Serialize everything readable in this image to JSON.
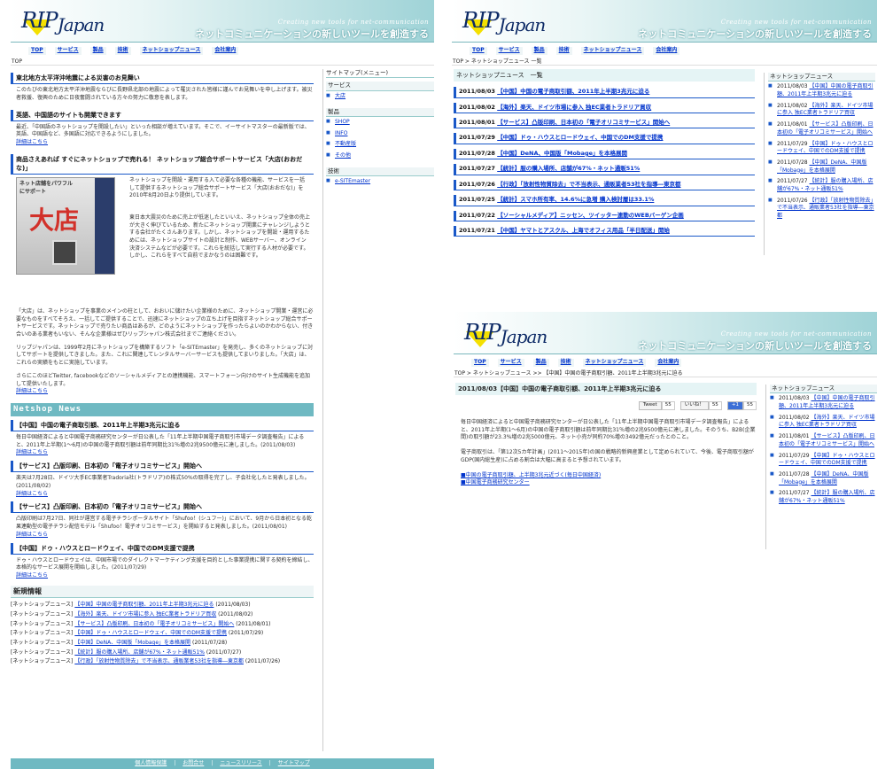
{
  "header": {
    "logo_rip": "RIP",
    "logo_japan": "Japan",
    "tagline_en": "Creating new tools for net-communication",
    "tagline_jp": "ネットコミュニケーションの新しいツールを創造する"
  },
  "nav": [
    "TOP",
    "サービス",
    "製品",
    "技術",
    "ネットショップニュース",
    "会社案内"
  ],
  "left": {
    "breadcrumb": "TOP",
    "sections": [
      {
        "title": "東北地方太平洋沖地震による災害のお見舞い",
        "body": "このたびの東北地方太平洋沖地震ならびに長野県北部の地震によって罹災された皆様に謹んでお見舞いを申し上げます。被災者救援、復興のために日夜奮闘されている方々の努力に敬意を表します。",
        "more": ""
      },
      {
        "title": "英語、中国語のサイトも開業できます",
        "body": "最近、「中国語のネットショップを開設したい」といった相談が増えています。そこで、イーサイトマスターの最新版では、英語、中国語など、多国語に対応できるようにしました。",
        "more": "詳細はこちら"
      },
      {
        "title": "商品さえあれば すぐにネットショップで売れる！ ネットショップ総合サポートサービス「大店(おおだな)」",
        "body": "ネットショップを開設・運用する入て必要な各種の機能、サービスを一括して提供するネットショップ総合サポートサービス「大店(おおだな)」を2010年8月20日より提供しています。",
        "more": ""
      }
    ],
    "odana_banner_title": "大店",
    "odana_banner_sub": "ネット店舗をパワフルにサポート",
    "odana_para2": "東日本大震災のために売上が低迷したといいえ、ネットショップ全体の売上が大きく伸びているため、新たにネットショップ開業にチャレンジしようとする会社がたくさんあります。しかし、ネットショップを開設・運用するためには、ネットショップサイトの設計と制作、WEBサーバー、オンライン決済システムなどが必要です。これらを統括して実行する人材が必要です。しかし、これらをすべて自前でまかなうのは困難です。",
    "odana_para3": "「大店」は、ネットショップを事業のメインの柱として、おおいに儲けたい企業様のために、ネットショップ開業・運営に必要なものをすべてそろえ、一括してご提供することで、迅速にネットショップの立ち上げを目指すネットショップ総合サポートサービスです。ネットショップで売りたい商品はあるが、どのようにネットショップを作ったらよいのかわからない、付き合いのある業者もいない、そんな企業様はぜひリップシャパン株式会社までご連絡ください。",
    "odana_para4": "リップジャパンは、1999年2月にネットショップを構築するソフト「e-SITEmaster」を発売し、多くのネットショップに対してサポートを提供してきました。また、これに関連してレンタルサーバーサービスも提供してまいりました。「大店」は、これらの実績をもとに実施しています。",
    "odana_para5": "さらにこのほどTwitter, facebookなどのソーシャルメディアとの連携機能、スマートフォーン向けのサイト生成機能を追加して提供いたします。",
    "odana_more": "詳細はこちら",
    "netshop_heading": "Netshop News",
    "news": [
      {
        "title": "【中国】中国の電子商取引額、2011年上半期3兆元に迫る",
        "body": "毎日中国経済によると中国電子商務研究センターが日公表した「11年上半期中国電子商取引市場データ調査報告」によると、2011年上半期(1～6月)の中国の電子商取引額は前年同期比31％増の2兆9500億元に達しました。(2011/08/03)"
      },
      {
        "title": "【サービス】凸版印刷、日本初の「電子オリコミサービス」開始へ",
        "body": "楽天は7月28日、ドイツ大手EC事業者Tradoria社(トラドリア)の株式50%の取得を完了し、子会社化したと発表しました。(2011/08/02)"
      },
      {
        "title": "【サービス】凸版印刷、日本初の「電子オリコミサービス」開始へ",
        "body": "凸版印刷は7月27日、同社が運営する電子チラシポータルサイト「Shufoo！(シュフー)」において、9月から日本初となる乾果連動型の電子チラシ配信モデル「Shufoo！電子オリコミサービス」を開始すると発表しました。(2011/08/01)"
      },
      {
        "title": "【中国】ドゥ・ハウスとロードウェイ、中国でのDM支援で提携",
        "body": "ドゥ・ハウスとロードウェイは、中国市場でのダイレクトマーケティング支援を目的とした事業提携に関する契約を締結し、本格的なサービス展開を開始しました。(2011/07/29)"
      }
    ],
    "more_label": "詳細はこちら",
    "new_info_heading": "新規情報",
    "new_info": [
      {
        "cat": "[ネットショップニュース]",
        "title": "【中国】中国の電子商取引額、2011年上半期3兆元に迫る",
        "date": "(2011/08/03)"
      },
      {
        "cat": "[ネットショップニュース]",
        "title": "【海外】楽天、ドイツ市場に参入 独EC業者トラドリア買収",
        "date": "(2011/08/02)"
      },
      {
        "cat": "[ネットショップニュース]",
        "title": "【サービス】凸版印刷、日本初の「電子オリコミサービス」開始へ",
        "date": "(2011/08/01)"
      },
      {
        "cat": "[ネットショップニュース]",
        "title": "【中国】ドゥ・ハウスとロードウェイ、中国でのDM支援で提携",
        "date": "(2011/07/29)"
      },
      {
        "cat": "[ネットショップニュース]",
        "title": "【中国】DeNA、中国版「Mobage」を本格展開",
        "date": "(2011/07/28)"
      },
      {
        "cat": "[ネットショップニュース]",
        "title": "【統計】服の購入場所、店舗が67%・ネット通販51%",
        "date": "(2011/07/27)"
      },
      {
        "cat": "[ネットショップニュース]",
        "title": "【行政】「放射性物質除去」で不当表示、通販業者53社を指導―東京都",
        "date": "(2011/07/26)"
      }
    ],
    "footer": [
      "個人情報保護",
      "お問合せ",
      "ニュースリリース",
      "サイトマップ"
    ]
  },
  "sitemap": {
    "title": "サイトマップ(メニュー)",
    "groups": [
      {
        "name": "サービス",
        "items": [
          "大店"
        ]
      },
      {
        "name": "製品",
        "items": [
          "SHOP",
          "INFO",
          "不動産版",
          "その他"
        ]
      },
      {
        "name": "技術",
        "items": [
          "e-SITEmaster"
        ]
      }
    ]
  },
  "tr": {
    "breadcrumb": "TOP > ネットショップニュース 一覧",
    "heading": "ネットショップニュース　一覧",
    "rows": [
      {
        "date": "2011/08/03",
        "title": "【中国】中国の電子商取引額、2011年上半期3兆元に迫る"
      },
      {
        "date": "2011/08/02",
        "title": "【海外】楽天、ドイツ市場に参入 独EC業者トラドリア買収"
      },
      {
        "date": "2011/08/01",
        "title": "【サービス】凸版印刷、日本初の「電子オリコミサービス」開始へ"
      },
      {
        "date": "2011/07/29",
        "title": "【中国】ドゥ・ハウスとロードウェイ、中国でのDM支援で提携"
      },
      {
        "date": "2011/07/28",
        "title": "【中国】DeNA、中国版「Mobage」を本格展開"
      },
      {
        "date": "2011/07/27",
        "title": "【統計】服の購入場所、店舗が67%・ネット通販51%"
      },
      {
        "date": "2011/07/26",
        "title": "【行政】「放射性物質除去」で不当表示、通販業者53社を指導―東京都"
      },
      {
        "date": "2011/07/25",
        "title": "【統計】スマホ所有率、14.6%に急増 購入検討層は33.1%"
      },
      {
        "date": "2011/07/22",
        "title": "【ソーシャルメディア】ニッセン、ツイッター連動のWEBバーゲン企画"
      },
      {
        "date": "2011/07/21",
        "title": "【中国】ヤマトとアスクル、上海でオフィス用品「半日配送」開始"
      }
    ],
    "side_title": "ネットショップニュース",
    "side": [
      {
        "date": "2011/08/03",
        "title": "【中国】中国の電子商取引額、2011年上半期3兆元に迫る"
      },
      {
        "date": "2011/08/02",
        "title": "【海外】楽天、ドイツ市場に参入 独EC業者トラドリア買収"
      },
      {
        "date": "2011/08/01",
        "title": "【サービス】凸版印刷、日本初の「電子オリコミサービス」開始へ"
      },
      {
        "date": "2011/07/29",
        "title": "【中国】ドゥ・ハウスとロードウェイ、中国でのDM支援で提携"
      },
      {
        "date": "2011/07/28",
        "title": "【中国】DeNA、中国版「Mobage」を本格展開"
      },
      {
        "date": "2011/07/27",
        "title": "【統計】服の購入場所、店舗が67%・ネット通販51%"
      },
      {
        "date": "2011/07/26",
        "title": "【行政】「放射性物質除去」で不当表示、通販業者53社を指導―東京都"
      }
    ]
  },
  "br": {
    "breadcrumb": "TOP > ネットショップニュース >> 【中国】中国の電子商取引額、2011年上半期3兆元に迫る",
    "heading": "2011/08/03【中国】中国の電子商取引額、2011年上半期3兆元に迫る",
    "tweet": "Tweet",
    "tweet_count": "55",
    "like": "いいね！",
    "like_count": "55",
    "plus": "+1",
    "plus_count": "55",
    "p1": "毎日中国経済によると中国電子商務研究センターが日公表した「11年上半期中国電子商取引市場データ調査報告」によると、2011年上半期(1～6月)の中国の電子商取引額は前年同期比31％増の2兆9500億元に達しました。そのうち、B2B(企業間)の取引額が23.3%増の2兆5000億元、ネット小売が同約70%増の3492億元だったとのこと。",
    "p2": "電子商取引は、「第12次5カ年計画」(2011～2015年)の国の戦略的新興産業として定められていて、今後、電子商取引額がGDP(国内総生産)に占める割合は大幅に高まると予想されています。",
    "links": [
      "■中国の電子商取引額、上半期3兆元近づく(毎日中国経済)",
      "■中国電子商務研究センター"
    ],
    "side_title": "ネットショップニュース",
    "side": [
      {
        "date": "2011/08/03",
        "title": "【中国】中国の電子商取引額、2011年上半期3兆元に迫る"
      },
      {
        "date": "2011/08/02",
        "title": "【海外】楽天、ドイツ市場に参入 独EC業者トラドリア買収"
      },
      {
        "date": "2011/08/01",
        "title": "【サービス】凸版印刷、日本初の「電子オリコミサービス」開始へ"
      },
      {
        "date": "2011/07/29",
        "title": "【中国】ドゥ・ハウスとロードウェイ、中国でのDM支援で提携"
      },
      {
        "date": "2011/07/28",
        "title": "【中国】DeNA、中国版「Mobage」を本格展開"
      },
      {
        "date": "2011/07/27",
        "title": "【統計】服の購入場所、店舗が67%・ネット通販51%"
      }
    ]
  }
}
